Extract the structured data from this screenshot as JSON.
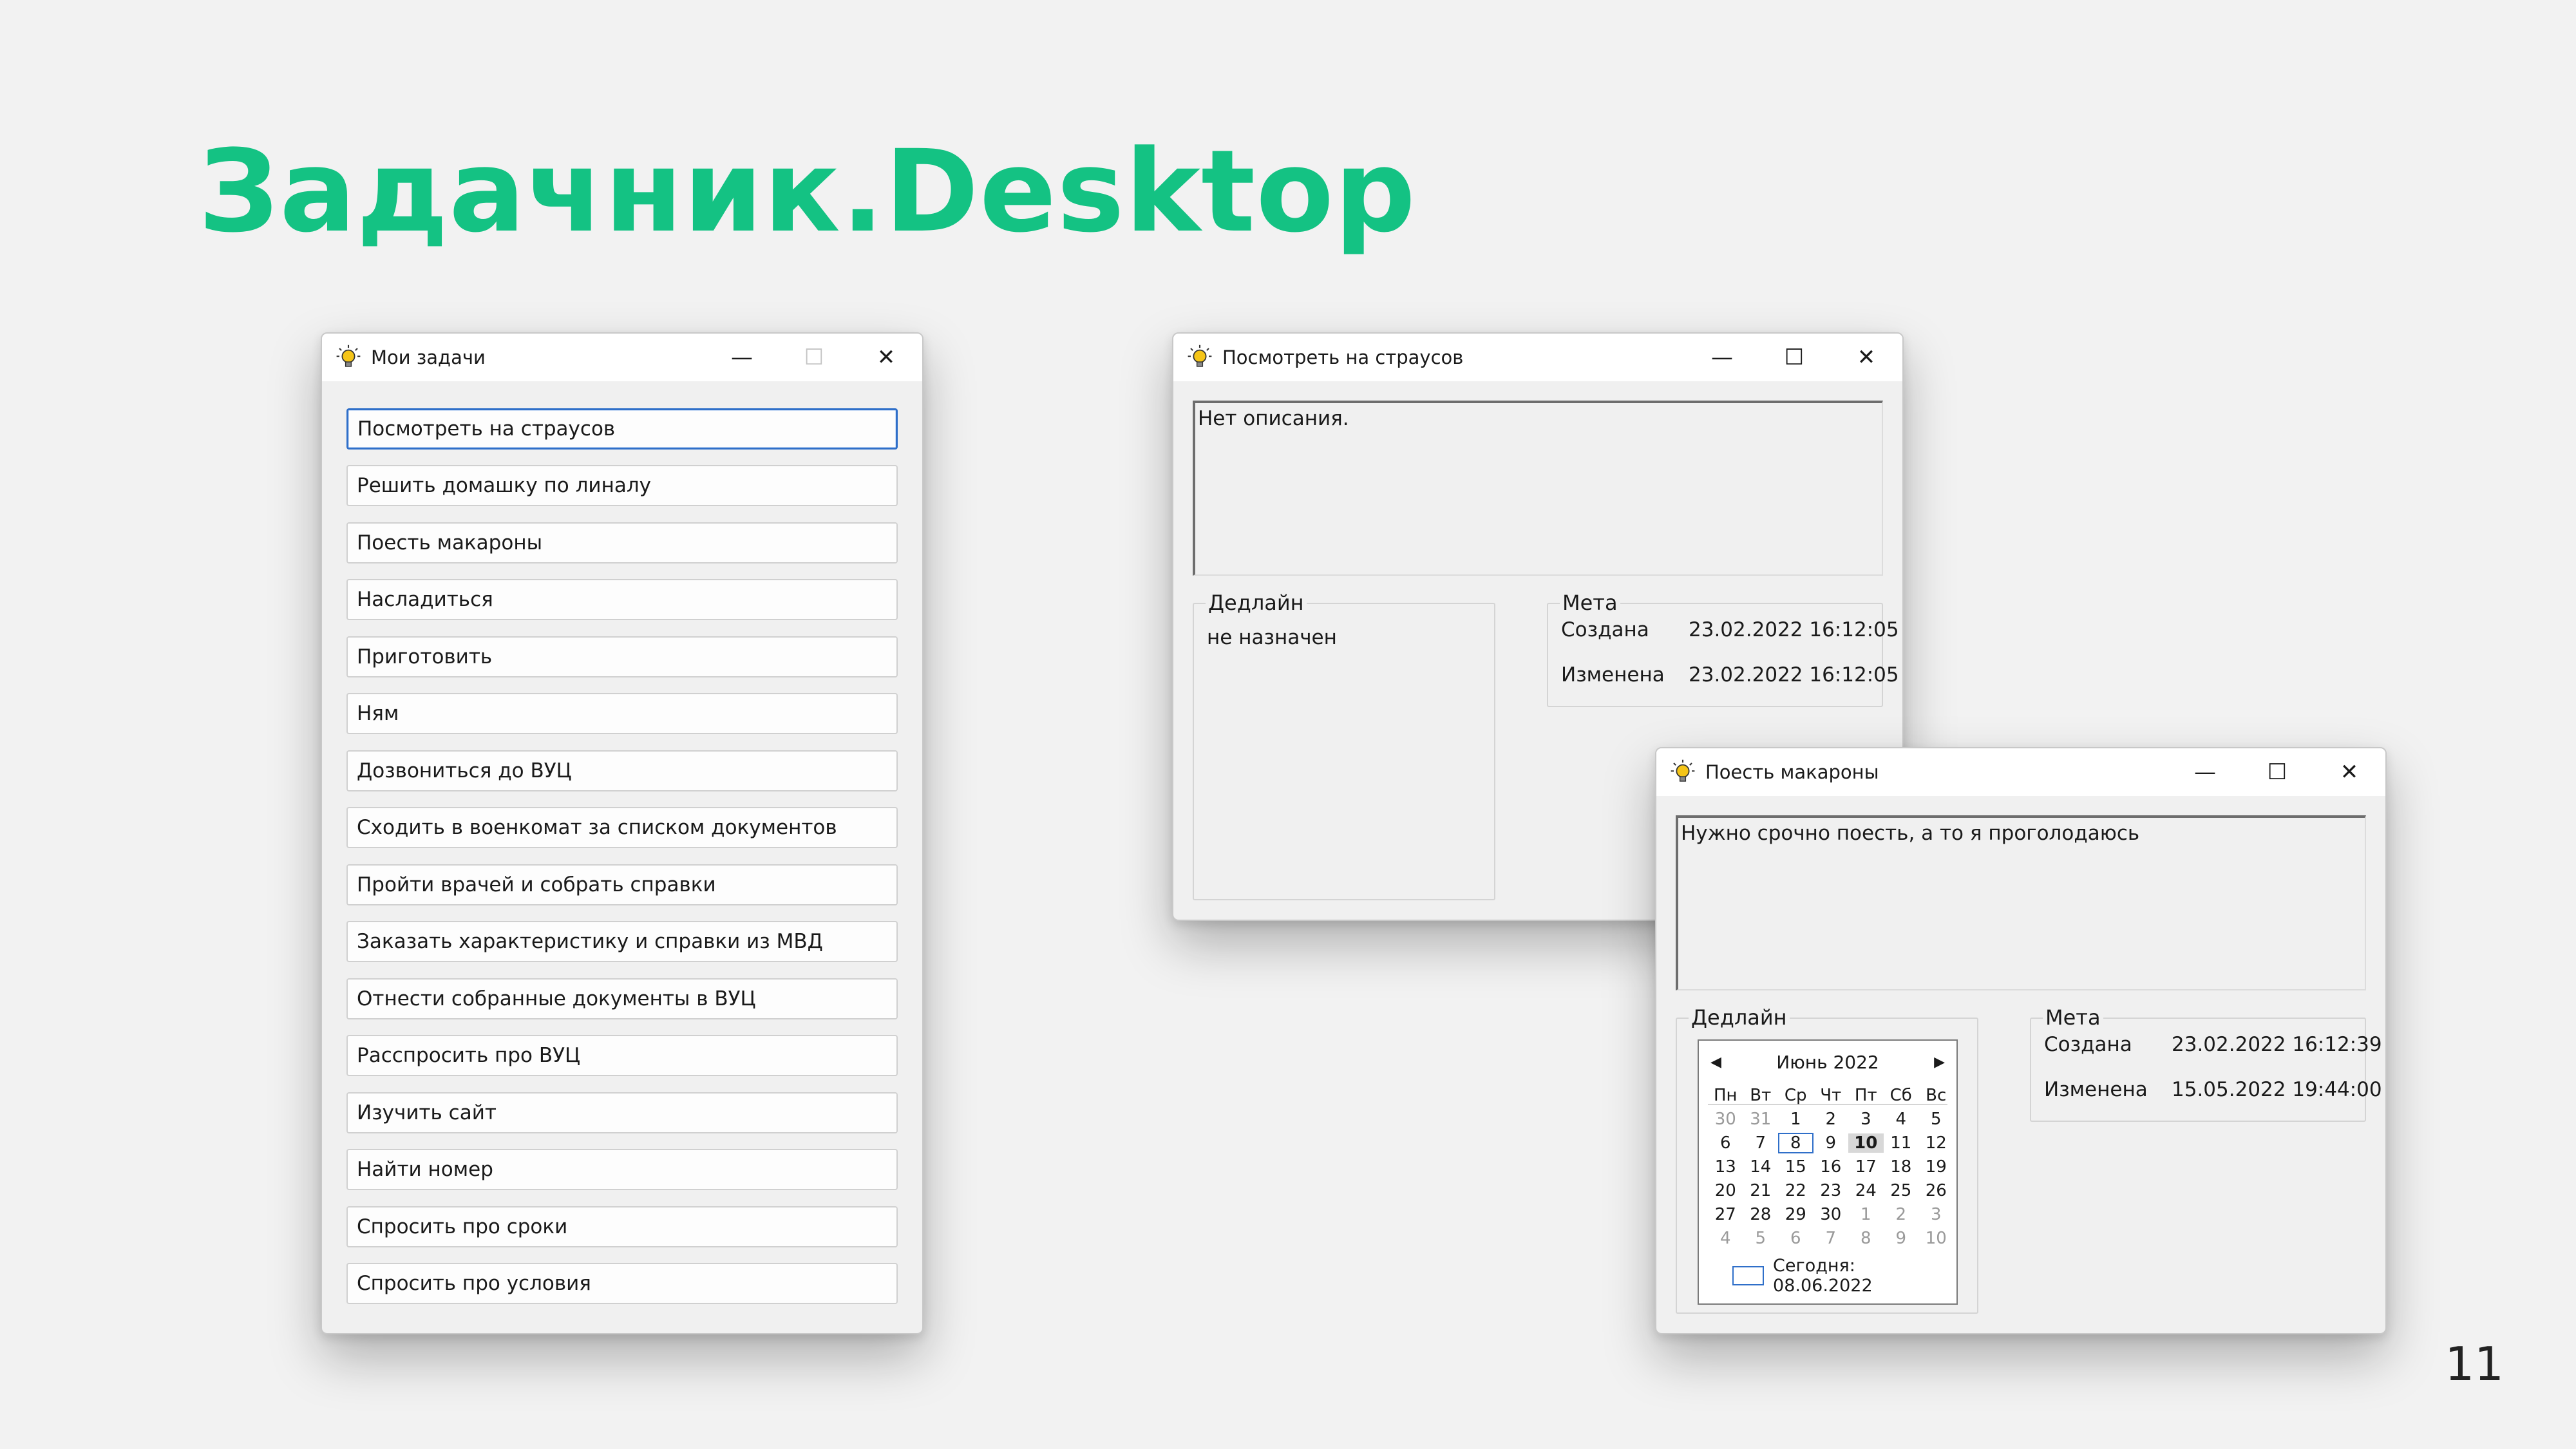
{
  "slide": {
    "title": "Задачник.Desktop",
    "page_number": "11"
  },
  "colors": {
    "title_green": "#14c283",
    "focus_blue": "#2f6fc9"
  },
  "icons": {
    "app_icon": "lightbulb-icon",
    "minimize": "minimize-icon",
    "maximize": "maximize-icon",
    "close": "close-icon"
  },
  "task_list_window": {
    "title": "Мои задачи",
    "caption": {
      "minimize": "—",
      "maximize": "☐",
      "close": "✕"
    },
    "tasks": [
      "Посмотреть на страусов",
      "Решить домашку по линалу",
      "Поесть макароны",
      "Насладиться",
      "Приготовить",
      "Ням",
      "Дозвониться до ВУЦ",
      "Сходить в военкомат за списком документов",
      "Пройти врачей и собрать справки",
      "Заказать характеристику и справки из МВД",
      "Отнести собранные документы в ВУЦ",
      "Расспросить про ВУЦ",
      "Изучить сайт",
      "Найти номер",
      "Спросить про сроки",
      "Спросить про условия"
    ]
  },
  "detail_window_1": {
    "title": "Посмотреть на страусов",
    "caption": {
      "minimize": "—",
      "maximize": "☐",
      "close": "✕"
    },
    "description": "Нет описания.",
    "deadline_label": "Дедлайн",
    "deadline_value": "не назначен",
    "meta_label": "Мета",
    "created_label": "Создана",
    "created_value": "23.02.2022 16:12:05",
    "modified_label": "Изменена",
    "modified_value": "23.02.2022 16:12:05"
  },
  "detail_window_2": {
    "title": "Поесть макароны",
    "caption": {
      "minimize": "—",
      "maximize": "☐",
      "close": "✕"
    },
    "description": "Нужно срочно поесть, а то я проголодаюсь",
    "deadline_label": "Дедлайн",
    "meta_label": "Мета",
    "created_label": "Создана",
    "created_value": "23.02.2022 16:12:39",
    "modified_label": "Изменена",
    "modified_value": "15.05.2022 19:44:00",
    "calendar": {
      "month_label": "Июнь 2022",
      "prev": "◀",
      "next": "▶",
      "weekdays": [
        "Пн",
        "Вт",
        "Ср",
        "Чт",
        "Пт",
        "Сб",
        "Вс"
      ],
      "weeks": [
        [
          "30",
          "31",
          "1",
          "2",
          "3",
          "4",
          "5"
        ],
        [
          "6",
          "7",
          "8",
          "9",
          "10",
          "11",
          "12"
        ],
        [
          "13",
          "14",
          "15",
          "16",
          "17",
          "18",
          "19"
        ],
        [
          "20",
          "21",
          "22",
          "23",
          "24",
          "25",
          "26"
        ],
        [
          "27",
          "28",
          "29",
          "30",
          "1",
          "2",
          "3"
        ],
        [
          "4",
          "5",
          "6",
          "7",
          "8",
          "9",
          "10"
        ]
      ],
      "selected_day": "8",
      "highlighted_day": "10",
      "today_label": "Сегодня: 08.06.2022"
    }
  }
}
